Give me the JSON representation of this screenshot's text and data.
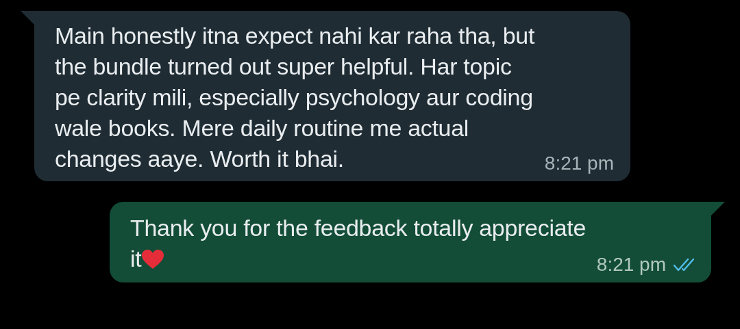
{
  "messages": [
    {
      "kind": "incoming",
      "text": "Main honestly itna expect nahi kar raha tha, but the bundle turned out super helpful. Har topic pe clarity mili, especially psychology aur coding wale books. Mere daily routine me actual changes aaye. Worth it bhai.",
      "time": "8:21 pm"
    },
    {
      "kind": "outgoing",
      "text": "Thank you for the feedback totally appreciate it",
      "heart": true,
      "time": "8:21 pm",
      "read": true
    }
  ]
}
